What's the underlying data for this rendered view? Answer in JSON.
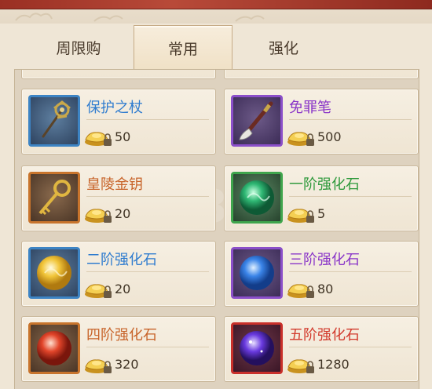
{
  "colors": {
    "blue": "#2f7ccf",
    "purple": "#8a36c8",
    "orange": "#c8642a",
    "green": "#2f9a3c",
    "red": "#d23a2c"
  },
  "tabs": [
    {
      "label": "周限购",
      "active": false
    },
    {
      "label": "常用",
      "active": true
    },
    {
      "label": "强化",
      "active": false
    }
  ],
  "items": [
    {
      "name": "保护之杖",
      "price": "50",
      "rarity": "blue",
      "icon": "staff-icon"
    },
    {
      "name": "免罪笔",
      "price": "500",
      "rarity": "purple",
      "icon": "brush-icon"
    },
    {
      "name": "皇陵金钥",
      "price": "20",
      "rarity": "orange",
      "icon": "golden-key-icon"
    },
    {
      "name": "一阶强化石",
      "price": "5",
      "rarity": "green",
      "icon": "green-orb-icon"
    },
    {
      "name": "二阶强化石",
      "price": "20",
      "rarity": "blue",
      "icon": "yellow-orb-icon"
    },
    {
      "name": "三阶强化石",
      "price": "80",
      "rarity": "purple",
      "icon": "blue-orb-icon"
    },
    {
      "name": "四阶强化石",
      "price": "320",
      "rarity": "orange",
      "icon": "red-orb-icon"
    },
    {
      "name": "五阶强化石",
      "price": "1280",
      "rarity": "red",
      "icon": "violet-orb-icon"
    }
  ]
}
